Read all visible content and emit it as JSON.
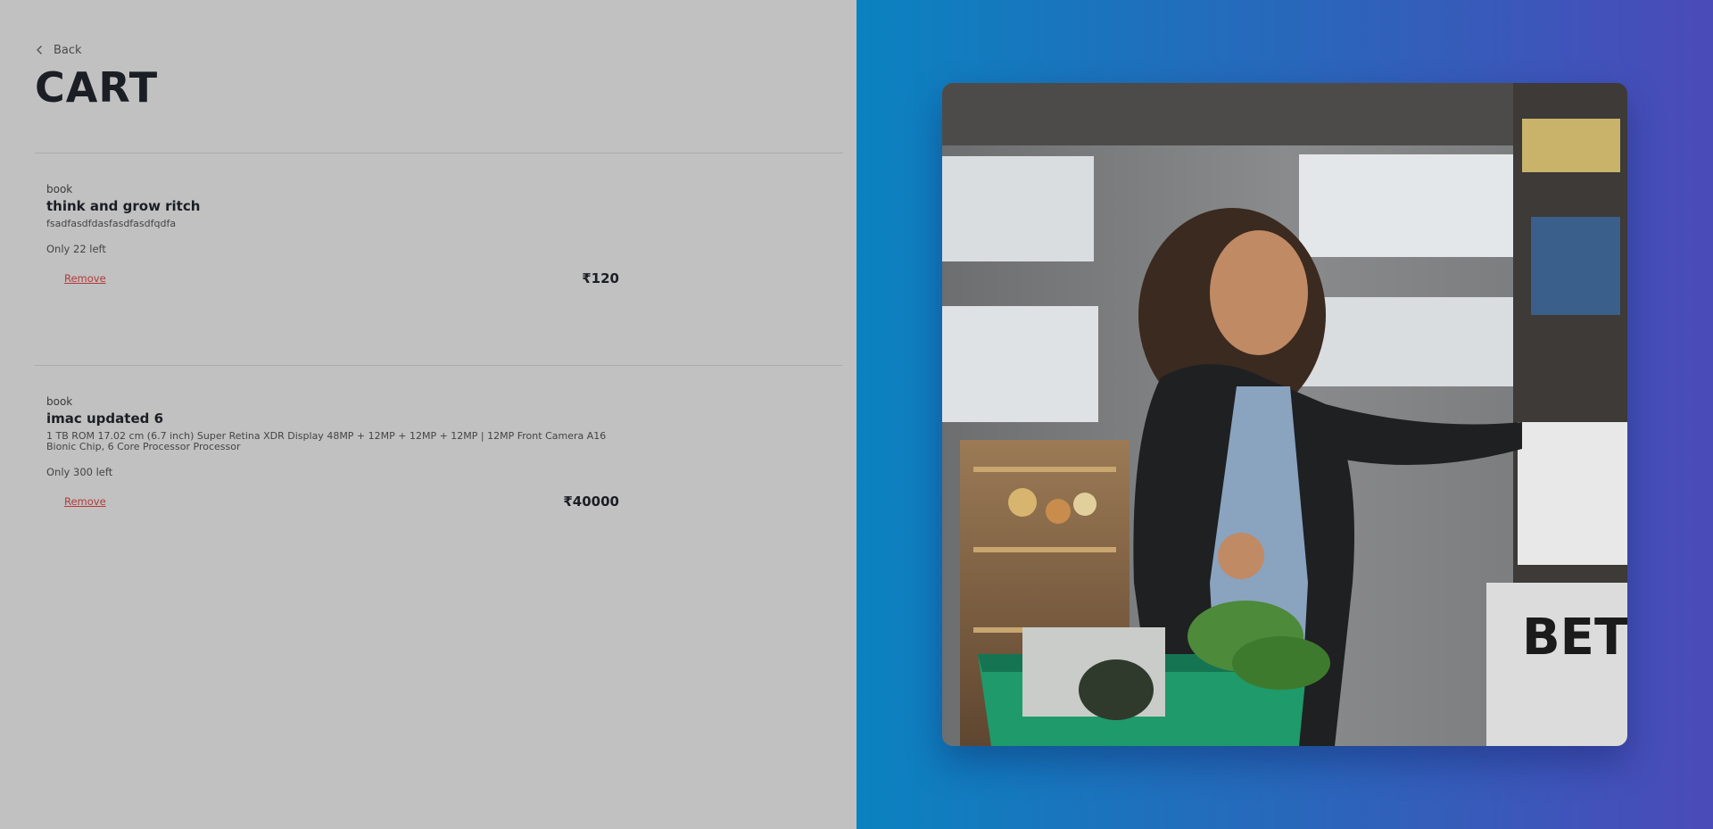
{
  "nav": {
    "back_label": "Back"
  },
  "page": {
    "title": "CART"
  },
  "cart": {
    "items": [
      {
        "category": "book",
        "name": "think and grow ritch",
        "description": "fsadfasdfdasfasdfasdfqdfa",
        "stock": "Only 22 left",
        "remove_label": "Remove",
        "price": "₹120"
      },
      {
        "category": "book",
        "name": "imac updated 6",
        "description": "1 TB ROM 17.02 cm (6.7 inch) Super Retina XDR Display 48MP + 12MP + 12MP + 12MP | 12MP Front Camera A16 Bionic Chip, 6 Core Processor Processor",
        "stock": "Only 300 left",
        "remove_label": "Remove",
        "price": "₹40000"
      }
    ]
  },
  "colors": {
    "panel_left": "#c1c1c1",
    "gradient_start": "#0b82c0",
    "gradient_end": "#4b4ab9",
    "remove_link": "#b33a3a",
    "text_dark": "#1b1e24"
  },
  "icons": {
    "back": "chevron-left-icon"
  }
}
